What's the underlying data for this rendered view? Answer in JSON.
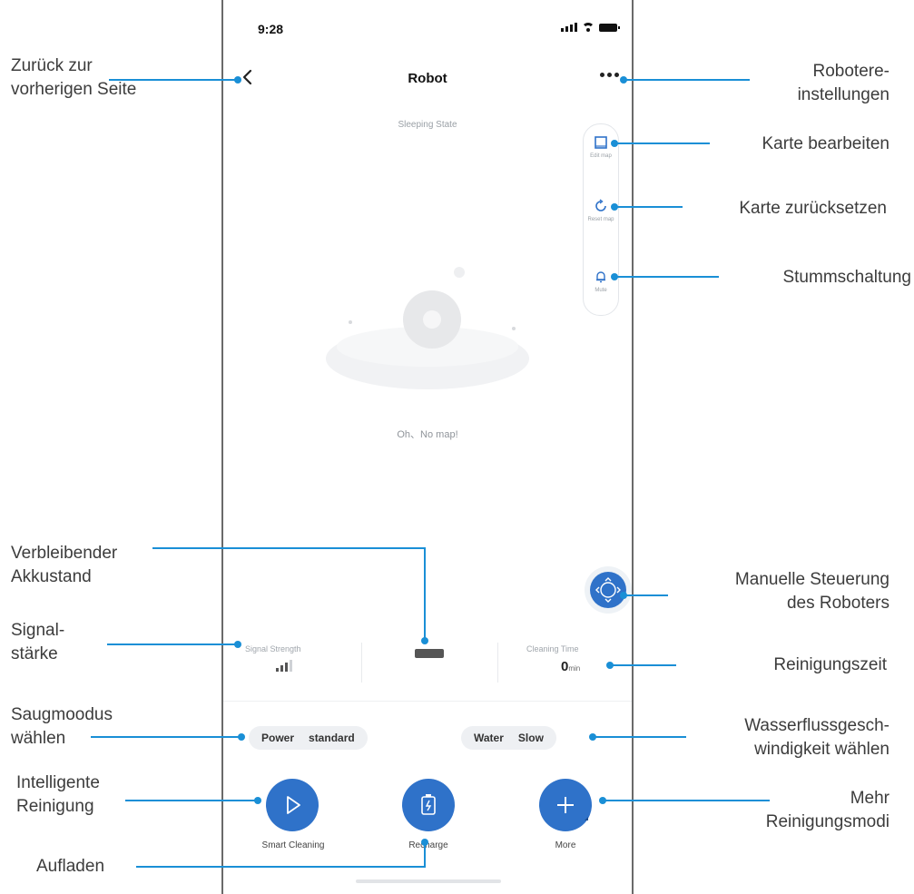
{
  "status_bar": {
    "time": "9:28"
  },
  "header": {
    "title": "Robot",
    "state": "Sleeping State"
  },
  "side_tools": [
    {
      "label": "Edit map",
      "icon": "edit-map-icon"
    },
    {
      "label": "Reset map",
      "icon": "reset-map-icon"
    },
    {
      "label": "Mute",
      "icon": "bell-icon"
    }
  ],
  "map": {
    "empty_text": "Oh、No map!"
  },
  "stats": {
    "signal_label": "Signal Strength",
    "cleaning_time_label": "Cleaning Time",
    "cleaning_time_value": "0",
    "cleaning_time_unit": "min"
  },
  "modes": {
    "power_label": "Power",
    "power_value": "standard",
    "water_label": "Water",
    "water_value": "Slow"
  },
  "actions": {
    "smart_cleaning": "Smart Cleaning",
    "recharge": "Recharge",
    "more": "More"
  },
  "callouts": {
    "back": "Zurück zur\nvorherigen Seite",
    "settings": "Robotere-\ninstellungen",
    "edit_map": "Karte bearbeiten",
    "reset_map": "Karte zurücksetzen",
    "mute": "Stummschaltung",
    "battery": "Verbleibender\nAkkustand",
    "manual_control": "Manuelle Steuerung\ndes Roboters",
    "signal": "Signal-\nstärke",
    "cleaning_time": "Reinigungszeit",
    "suction": "Saugmoodus\nwählen",
    "water_flow": "Wasserflussgesch-\nwindigkeit wählen",
    "smart_cleaning": "Intelligente\nReinigung",
    "more_modes": "Mehr\nReinigungsmodi",
    "recharge": "Aufladen"
  },
  "colors": {
    "accent": "#2f72c9",
    "leader": "#1a8fd6"
  }
}
